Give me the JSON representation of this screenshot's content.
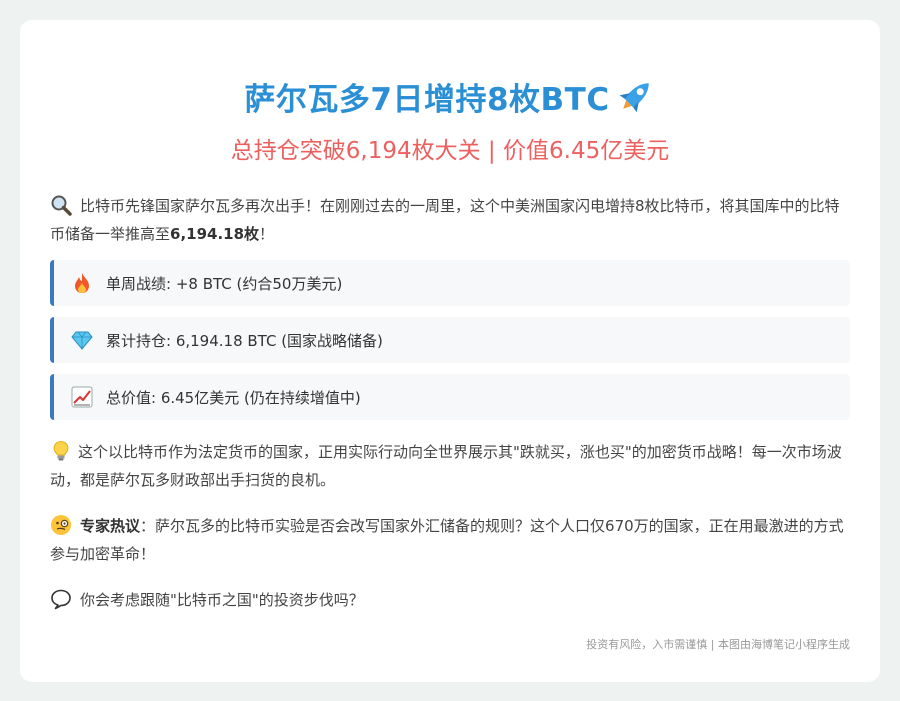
{
  "header": {
    "title": "萨尔瓦多7日增持8枚BTC",
    "subtitle": "总持仓突破6,194枚大关 | 价值6.45亿美元"
  },
  "intro": {
    "text_before": "比特币先锋国家萨尔瓦多再次出手！在刚刚过去的一周里，这个中美洲国家闪电增持8枚比特币，将其国库中的比特币储备一举推高至",
    "highlight": "6,194.18枚",
    "text_after": "！"
  },
  "stats": [
    {
      "icon": "fire-icon",
      "label": "单周战绩: +8 BTC (约合50万美元)"
    },
    {
      "icon": "diamond-icon",
      "label": "累计持仓: 6,194.18 BTC (国家战略储备)"
    },
    {
      "icon": "chart-up-icon",
      "label": "总价值: 6.45亿美元 (仍在持续增值中)"
    }
  ],
  "insight": {
    "text": "这个以比特币作为法定货币的国家，正用实际行动向全世界展示其\"跌就买，涨也买\"的加密货币战略！每一次市场波动，都是萨尔瓦多财政部出手扫货的良机。"
  },
  "expert": {
    "label": "专家热议",
    "colon": "：",
    "text": "萨尔瓦多的比特币实验是否会改写国家外汇储备的规则？这个人口仅670万的国家，正在用最激进的方式参与加密革命！"
  },
  "question": {
    "text": "你会考虑跟随\"比特币之国\"的投资步伐吗？"
  },
  "footer": {
    "text": "投资有风险，入市需谨慎 | 本图由海博笔记小程序生成"
  },
  "colors": {
    "title": "#2b8fd6",
    "subtitle": "#ec6160",
    "stat_border": "#3a78c6"
  }
}
